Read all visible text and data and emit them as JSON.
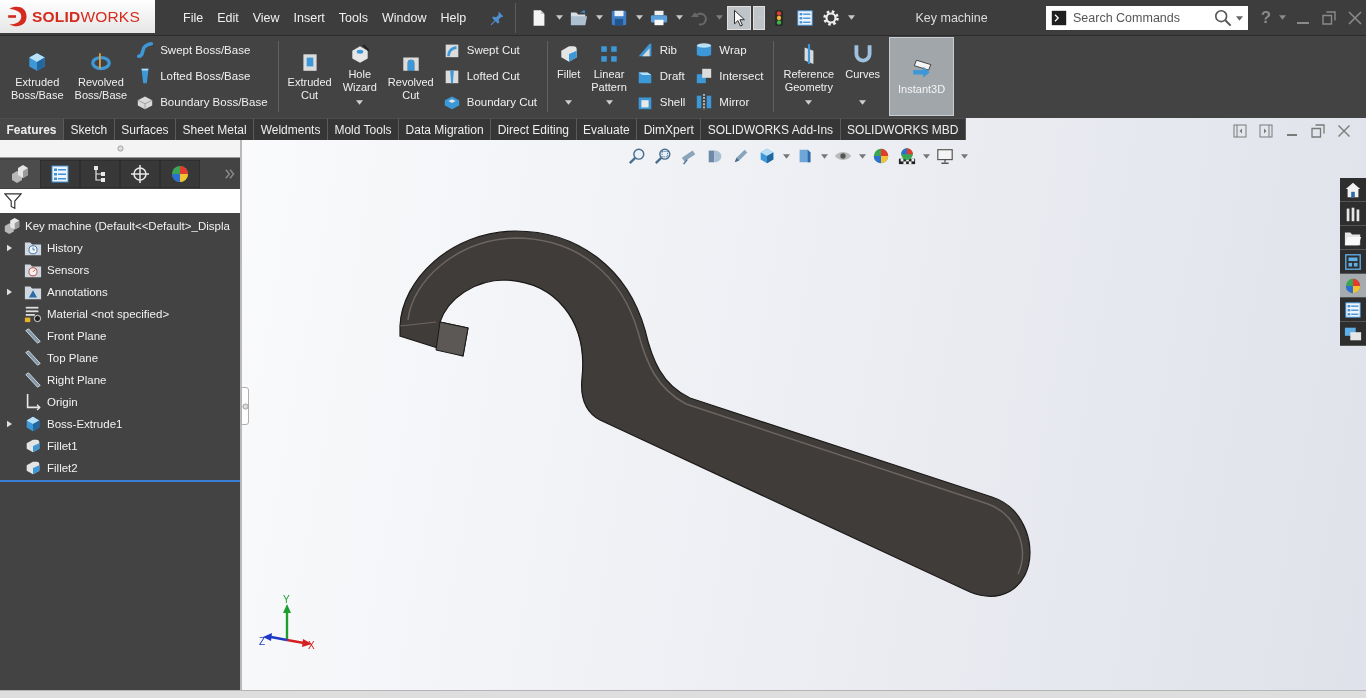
{
  "title_bar": {
    "logo": "**SOLID**WORKS",
    "menu": [
      "File",
      "Edit",
      "View",
      "Insert",
      "Tools",
      "Window",
      "Help"
    ],
    "quick_access": [
      {
        "kind": "new",
        "dropdown": true,
        "selected": false,
        "disabled": false
      },
      {
        "kind": "open",
        "dropdown": true,
        "selected": false,
        "disabled": false
      },
      {
        "kind": "save",
        "dropdown": true,
        "selected": false,
        "disabled": false
      },
      {
        "kind": "print",
        "dropdown": true,
        "selected": false,
        "disabled": false
      },
      {
        "kind": "undo",
        "dropdown": true,
        "selected": false,
        "disabled": true
      },
      {
        "kind": "select",
        "dropdown": true,
        "selected": true,
        "disabled": false
      },
      {
        "kind": "rebuild",
        "dropdown": false,
        "selected": false,
        "disabled": false
      },
      {
        "kind": "properties",
        "dropdown": false,
        "selected": false,
        "disabled": false
      },
      {
        "kind": "options",
        "dropdown": true,
        "selected": false,
        "disabled": false
      }
    ],
    "document_title": "Key machine",
    "search": {
      "placeholder": "Search Commands"
    },
    "help": "?"
  },
  "ribbon": {
    "groups": [
      {
        "large": [
          {
            "kind": "extrude",
            "lines": [
              "Extruded",
              "Boss/Base"
            ],
            "dropdown": false,
            "selected": false
          },
          {
            "kind": "revolve",
            "lines": [
              "Revolved",
              "Boss/Base"
            ],
            "dropdown": false,
            "selected": false
          }
        ],
        "columns": [
          [
            {
              "kind": "sweep",
              "label": "Swept Boss/Base"
            },
            {
              "kind": "loft",
              "label": "Lofted Boss/Base"
            },
            {
              "kind": "boundary",
              "label": "Boundary Boss/Base"
            }
          ]
        ]
      },
      {
        "large": [
          {
            "kind": "extrude-cut",
            "lines": [
              "Extruded",
              "Cut"
            ],
            "dropdown": false,
            "selected": false
          },
          {
            "kind": "hole",
            "lines": [
              "Hole",
              "Wizard"
            ],
            "dropdown": true,
            "selected": false
          },
          {
            "kind": "revolve-cut",
            "lines": [
              "Revolved",
              "Cut"
            ],
            "dropdown": false,
            "selected": false
          }
        ],
        "columns": [
          [
            {
              "kind": "sweep-cut",
              "label": "Swept Cut"
            },
            {
              "kind": "loft-cut",
              "label": "Lofted Cut"
            },
            {
              "kind": "boundary-cut",
              "label": "Boundary Cut"
            }
          ]
        ]
      },
      {
        "large": [
          {
            "kind": "fillet",
            "lines": [
              "Fillet"
            ],
            "dropdown": true,
            "selected": false
          },
          {
            "kind": "pattern",
            "lines": [
              "Linear",
              "Pattern"
            ],
            "dropdown": true,
            "selected": false
          }
        ],
        "columns": [
          [
            {
              "kind": "rib",
              "label": "Rib"
            },
            {
              "kind": "draft",
              "label": "Draft"
            },
            {
              "kind": "shell",
              "label": "Shell"
            }
          ],
          [
            {
              "kind": "wrap",
              "label": "Wrap"
            },
            {
              "kind": "intersect",
              "label": "Intersect"
            },
            {
              "kind": "mirror",
              "label": "Mirror"
            }
          ]
        ]
      },
      {
        "large": [
          {
            "kind": "refgeom",
            "lines": [
              "Reference",
              "Geometry"
            ],
            "dropdown": true,
            "selected": false
          },
          {
            "kind": "curves",
            "lines": [
              "Curves"
            ],
            "dropdown": true,
            "selected": false
          },
          {
            "kind": "instant3d",
            "lines": [
              "Instant3D"
            ],
            "dropdown": false,
            "selected": true
          }
        ]
      }
    ]
  },
  "command_tabs": [
    {
      "label": "Features",
      "selected": true
    },
    {
      "label": "Sketch",
      "selected": false
    },
    {
      "label": "Surfaces",
      "selected": false
    },
    {
      "label": "Sheet Metal",
      "selected": false
    },
    {
      "label": "Weldments",
      "selected": false
    },
    {
      "label": "Mold Tools",
      "selected": false
    },
    {
      "label": "Data Migration",
      "selected": false
    },
    {
      "label": "Direct Editing",
      "selected": false
    },
    {
      "label": "Evaluate",
      "selected": false
    },
    {
      "label": "DimXpert",
      "selected": false
    },
    {
      "label": "SOLIDWORKS Add-Ins",
      "selected": false
    },
    {
      "label": "SOLIDWORKS MBD",
      "selected": false
    }
  ],
  "feature_manager": {
    "panel_tabs": [
      {
        "kind": "features",
        "selected": true
      },
      {
        "kind": "property",
        "selected": false
      },
      {
        "kind": "configuration",
        "selected": false
      },
      {
        "kind": "dimxpert",
        "selected": false
      },
      {
        "kind": "display",
        "selected": false
      }
    ],
    "tree": {
      "label": "Key machine (Default<<Default>_Displa",
      "kind": "part",
      "children": [
        {
          "label": "History",
          "kind": "history",
          "expandable": true
        },
        {
          "label": "Sensors",
          "kind": "sensors",
          "expandable": false
        },
        {
          "label": "Annotations",
          "kind": "annotations",
          "expandable": true
        },
        {
          "label": "Material <not specified>",
          "kind": "material",
          "expandable": false
        },
        {
          "label": "Front Plane",
          "kind": "plane",
          "expandable": false
        },
        {
          "label": "Top Plane",
          "kind": "plane",
          "expandable": false
        },
        {
          "label": "Right Plane",
          "kind": "plane",
          "expandable": false
        },
        {
          "label": "Origin",
          "kind": "origin",
          "expandable": false
        },
        {
          "label": "Boss-Extrude1",
          "kind": "extrude",
          "expandable": true
        },
        {
          "label": "Fillet1",
          "kind": "fillet",
          "expandable": false
        },
        {
          "label": "Fillet2",
          "kind": "fillet",
          "expandable": false
        }
      ]
    }
  },
  "viewport": {
    "task_pane": [
      {
        "kind": "home",
        "selected": false
      },
      {
        "kind": "library",
        "selected": false
      },
      {
        "kind": "explorer",
        "selected": false
      },
      {
        "kind": "palette",
        "selected": false
      },
      {
        "kind": "appearances",
        "selected": true
      },
      {
        "kind": "custom",
        "selected": false
      },
      {
        "kind": "forum",
        "selected": false
      }
    ],
    "triad": [
      {
        "label": "Y",
        "color": "#1e9e2e"
      },
      {
        "label": "X",
        "color": "#d42020"
      },
      {
        "label": "Z",
        "color": "#2038c8"
      }
    ]
  }
}
